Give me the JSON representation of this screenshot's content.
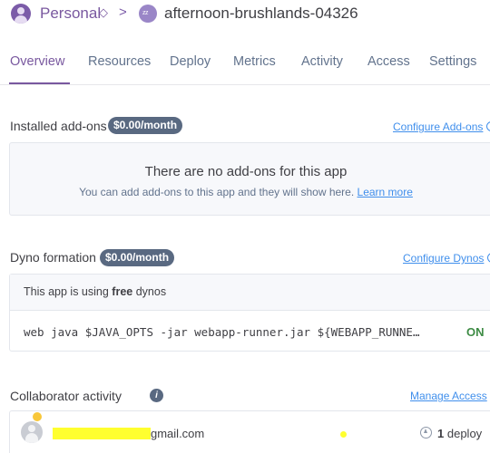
{
  "header": {
    "org_name": "Personal",
    "org_switch_glyph": "◇",
    "separator_glyph": ">",
    "app_icon_label": "zz",
    "app_name": "afternoon-brushlands-04326",
    "org_icon": "user-avatar-icon",
    "app_icon": "app-space-icon"
  },
  "tabs": [
    {
      "label": "Overview",
      "active": true
    },
    {
      "label": "Resources"
    },
    {
      "label": "Deploy"
    },
    {
      "label": "Metrics"
    },
    {
      "label": "Activity"
    },
    {
      "label": "Access"
    },
    {
      "label": "Settings"
    }
  ],
  "addons": {
    "title": "Installed add-ons",
    "price": "$0.00/month",
    "configure_link": "Configure Add-ons",
    "empty_title": "There are no add-ons for this app",
    "empty_subtitle": "You can add add-ons to this app and they will show here.",
    "learn_more": "Learn more"
  },
  "dyno": {
    "title": "Dyno formation",
    "price": "$0.00/month",
    "configure_link": "Configure Dynos",
    "note_prefix": "This app is using",
    "note_bold": "free",
    "note_suffix": "dynos",
    "command": "web  java $JAVA_OPTS -jar webapp-runner.jar ${WEBAPP_RUNNE…",
    "status": "ON",
    "status_color": "#3d8b44"
  },
  "collaborators": {
    "title": "Collaborator activity",
    "info_glyph": "i",
    "manage_link": "Manage Access",
    "email_suffix": "gmail.com",
    "deploy_count": "1",
    "deploy_label": "deploy"
  },
  "colors": {
    "accent": "#79589f",
    "link": "#408fec",
    "badge": "#596981",
    "redaction": "#ffff2f"
  }
}
